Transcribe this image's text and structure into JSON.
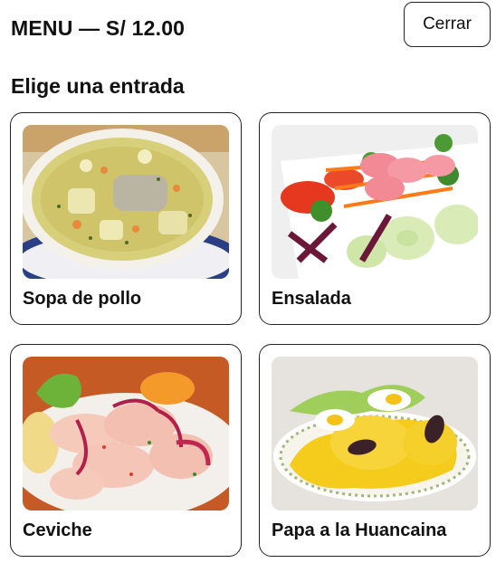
{
  "header": {
    "title": "MENU — S/ 12.00",
    "close_label": "Cerrar"
  },
  "section": {
    "subtitle": "Elige una entrada"
  },
  "dishes": [
    {
      "label": "Sopa de pollo",
      "image": "chicken-soup"
    },
    {
      "label": "Ensalada",
      "image": "salad"
    },
    {
      "label": "Ceviche",
      "image": "ceviche"
    },
    {
      "label": "Papa a la Huancaina",
      "image": "papa-huancaina"
    }
  ]
}
